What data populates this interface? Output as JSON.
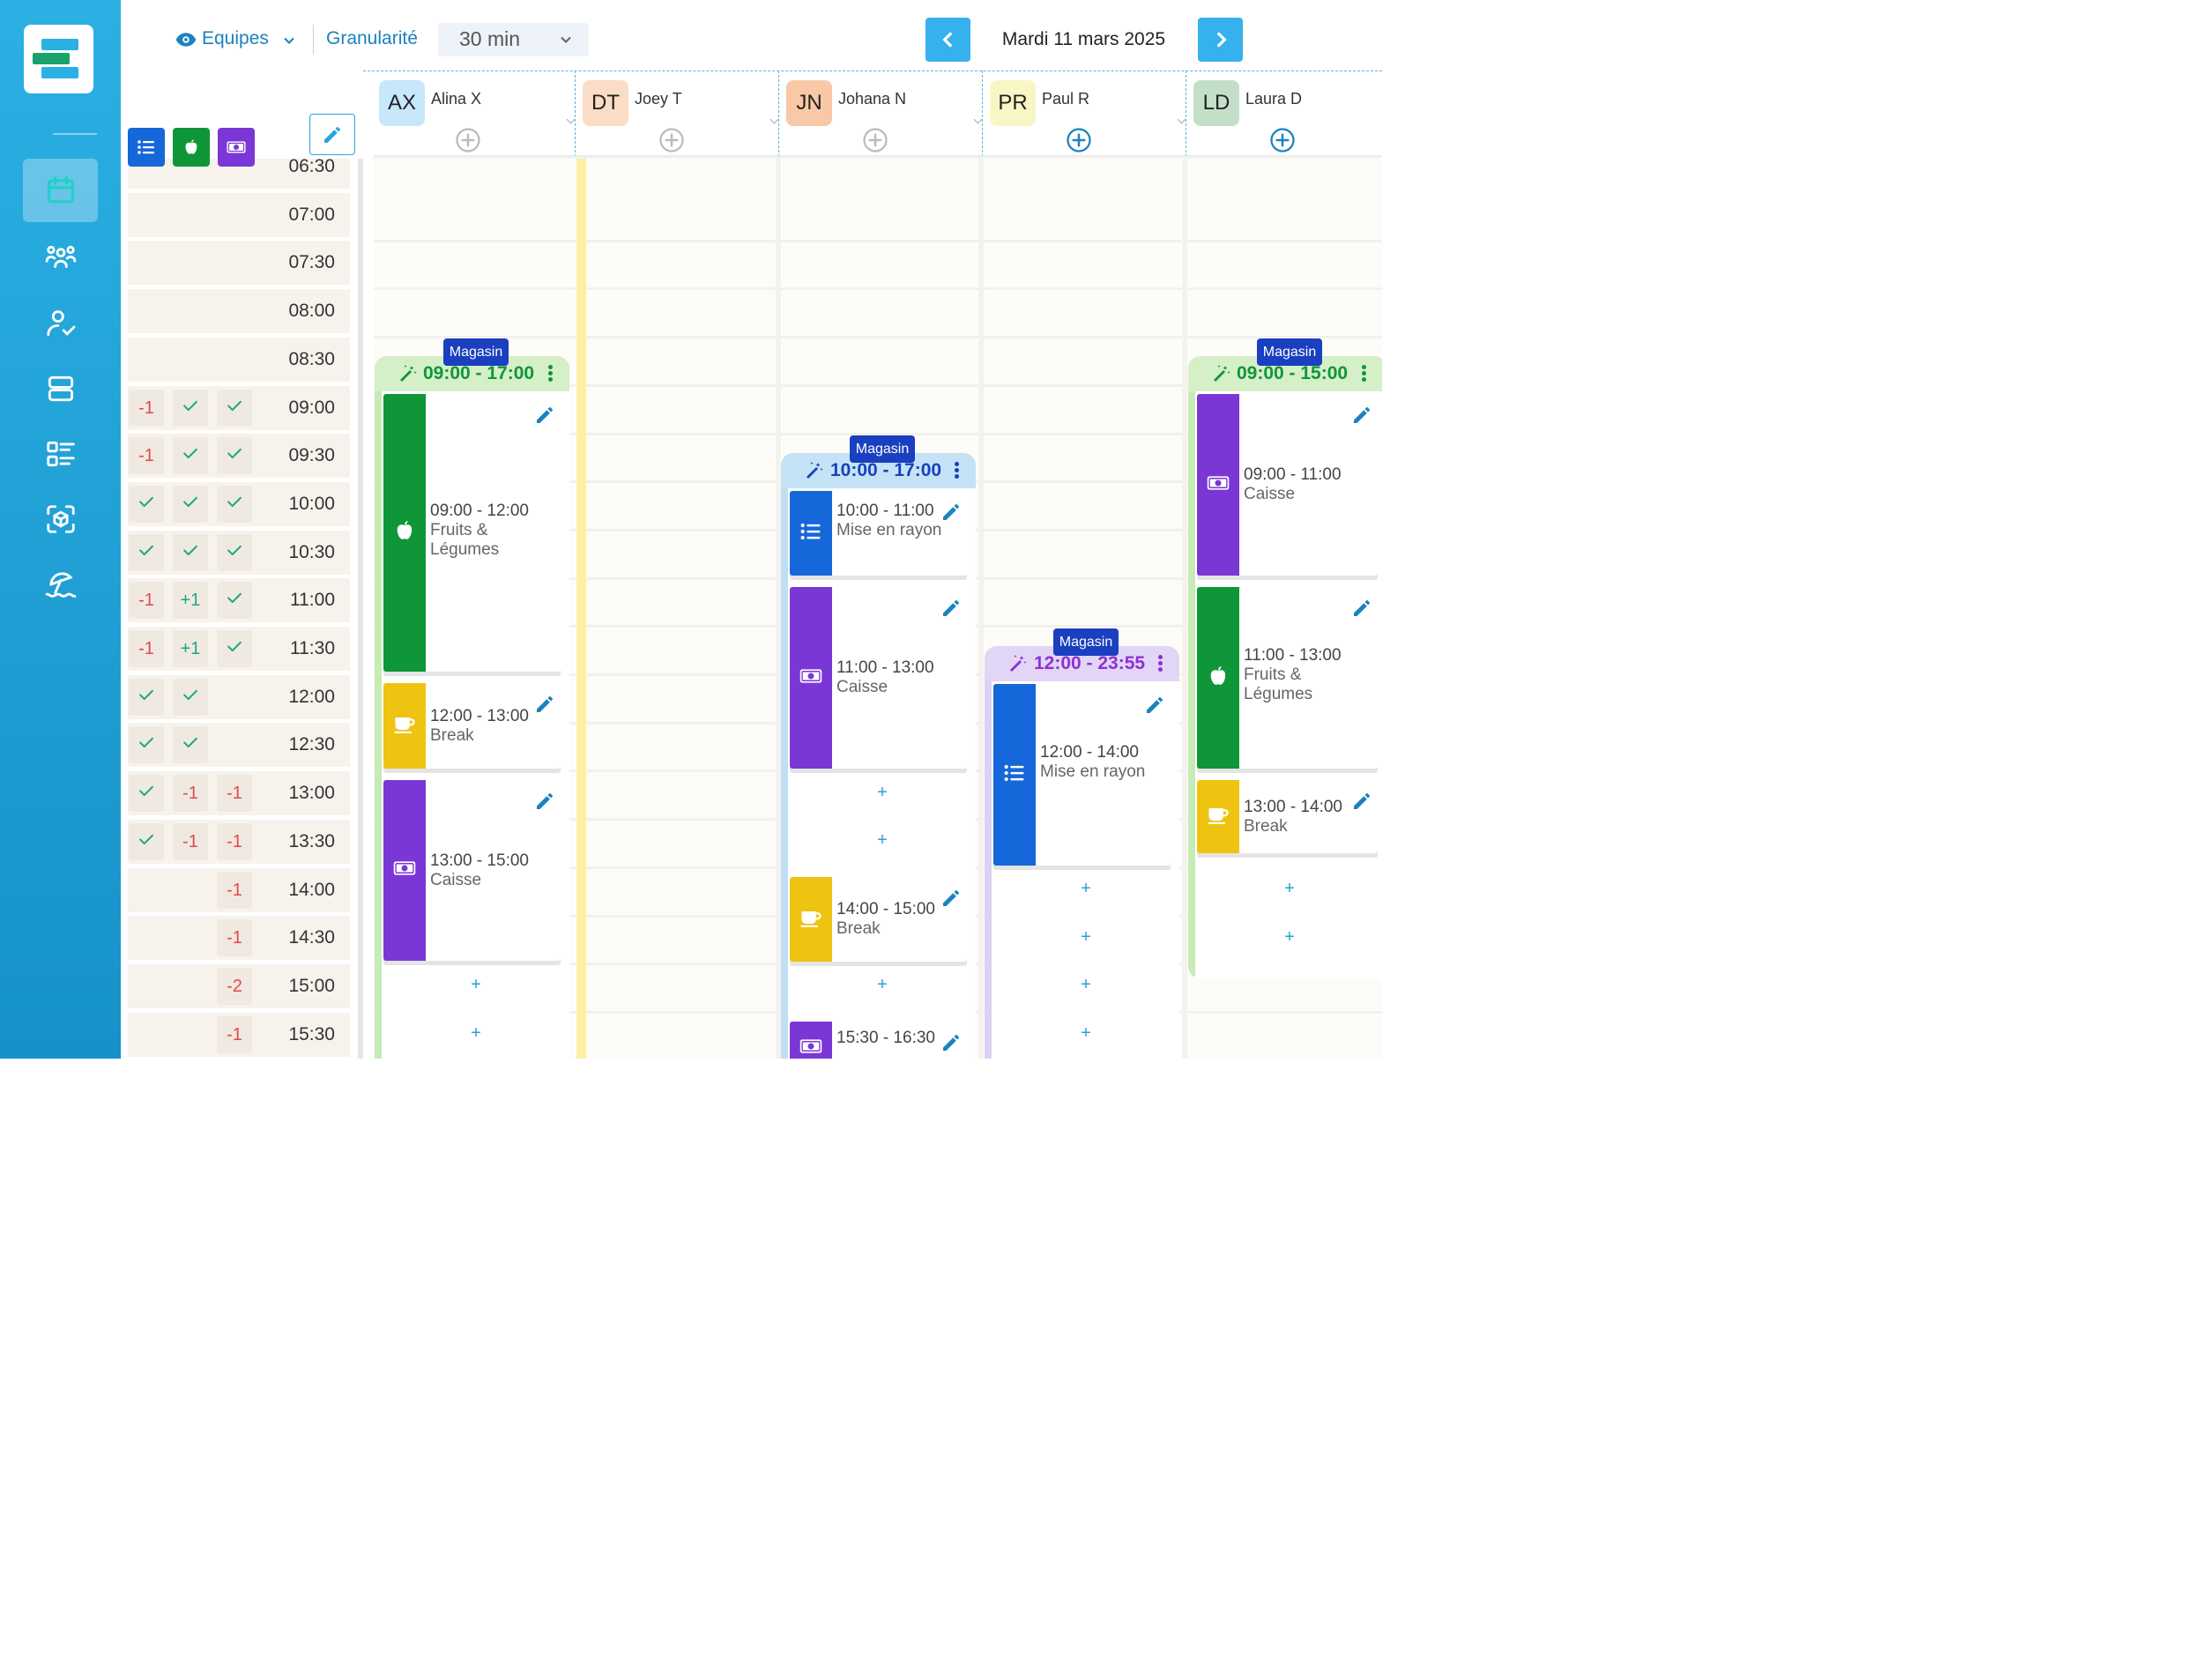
{
  "toolbar": {
    "view_label": "Equipes",
    "granularity_label": "Granularité",
    "granularity_value": "30 min",
    "date": "Mardi 11 mars 2025",
    "prev_icon": "chevron-left-icon",
    "next_icon": "chevron-right-icon"
  },
  "sidebar": {
    "items": [
      {
        "name": "calendar",
        "icon": "calendar-icon",
        "active": true
      },
      {
        "name": "teams",
        "icon": "users-group-icon"
      },
      {
        "name": "user-check",
        "icon": "user-check-icon"
      },
      {
        "name": "layout",
        "icon": "layout-rows-icon"
      },
      {
        "name": "task-list",
        "icon": "task-list-icon"
      },
      {
        "name": "scan",
        "icon": "scan-cube-icon"
      },
      {
        "name": "vacation",
        "icon": "beach-umbrella-icon"
      }
    ]
  },
  "activity_tags": [
    {
      "icon": "list-icon",
      "color": "#1667d9"
    },
    {
      "icon": "apple-icon",
      "color": "#0f9638"
    },
    {
      "icon": "money-icon",
      "color": "#7a37d6"
    }
  ],
  "employees": [
    {
      "initials": "AX",
      "name": "Alina X",
      "color": "#c7e7fb"
    },
    {
      "initials": "DT",
      "name": "Joey T",
      "color": "#fbdcc6"
    },
    {
      "initials": "JN",
      "name": "Johana N",
      "color": "#f9c8a6"
    },
    {
      "initials": "PR",
      "name": "Paul R",
      "color": "#f8f6c4"
    },
    {
      "initials": "LD",
      "name": "Laura D",
      "color": "#c3dfc8"
    }
  ],
  "time_rows": [
    {
      "time": "06:30",
      "c1": "",
      "c2": "",
      "c3": ""
    },
    {
      "time": "07:00",
      "c1": "",
      "c2": "",
      "c3": ""
    },
    {
      "time": "07:30",
      "c1": "",
      "c2": "",
      "c3": ""
    },
    {
      "time": "08:00",
      "c1": "",
      "c2": "",
      "c3": ""
    },
    {
      "time": "08:30",
      "c1": "",
      "c2": "",
      "c3": ""
    },
    {
      "time": "09:00",
      "c1": "-1",
      "c2": "check",
      "c3": "check"
    },
    {
      "time": "09:30",
      "c1": "-1",
      "c2": "check",
      "c3": "check"
    },
    {
      "time": "10:00",
      "c1": "check",
      "c2": "check",
      "c3": "check"
    },
    {
      "time": "10:30",
      "c1": "check",
      "c2": "check",
      "c3": "check"
    },
    {
      "time": "11:00",
      "c1": "-1",
      "c2": "+1",
      "c3": "check"
    },
    {
      "time": "11:30",
      "c1": "-1",
      "c2": "+1",
      "c3": "check"
    },
    {
      "time": "12:00",
      "c1": "check",
      "c2": "check",
      "c3": ""
    },
    {
      "time": "12:30",
      "c1": "check",
      "c2": "check",
      "c3": ""
    },
    {
      "time": "13:00",
      "c1": "check",
      "c2": "-1",
      "c3": "-1"
    },
    {
      "time": "13:30",
      "c1": "check",
      "c2": "-1",
      "c3": "-1"
    },
    {
      "time": "14:00",
      "c1": "",
      "c2": "",
      "c3": "-1"
    },
    {
      "time": "14:30",
      "c1": "",
      "c2": "",
      "c3": "-1"
    },
    {
      "time": "15:00",
      "c1": "",
      "c2": "",
      "c3": "-2"
    },
    {
      "time": "15:30",
      "c1": "",
      "c2": "",
      "c3": "-1"
    }
  ],
  "shifts": [
    {
      "employee": "Alina X",
      "tag": "Magasin",
      "time": "09:00 - 17:00",
      "color": "#0f9638",
      "tasks": [
        {
          "time": "09:00 - 12:00",
          "label": "Fruits & Légumes",
          "icon": "apple-icon",
          "color": "#0f9638"
        },
        {
          "time": "12:00 - 13:00",
          "label": "Break",
          "icon": "coffee-cup-icon",
          "color": "#efc312"
        },
        {
          "time": "13:00 - 15:00",
          "label": "Caisse",
          "icon": "money-icon",
          "color": "#7a37d6"
        }
      ]
    },
    {
      "employee": "Johana N",
      "tag": "Magasin",
      "time": "10:00 - 17:00",
      "color": "#1a3fc0",
      "tasks": [
        {
          "time": "10:00 - 11:00",
          "label": "Mise en rayon",
          "icon": "list-icon",
          "color": "#1667d9"
        },
        {
          "time": "11:00 - 13:00",
          "label": "Caisse",
          "icon": "money-icon",
          "color": "#7a37d6"
        },
        {
          "time": "14:00 - 15:00",
          "label": "Break",
          "icon": "coffee-cup-icon",
          "color": "#efc312"
        },
        {
          "time": "15:30 - 16:30",
          "label": "",
          "icon": "money-icon",
          "color": "#7a37d6"
        }
      ]
    },
    {
      "employee": "Paul R",
      "tag": "Magasin",
      "time": "12:00 - 23:55",
      "color": "#8f30d6",
      "tasks": [
        {
          "time": "12:00 - 14:00",
          "label": "Mise en rayon",
          "icon": "list-icon",
          "color": "#1667d9"
        }
      ]
    },
    {
      "employee": "Laura D",
      "tag": "Magasin",
      "time": "09:00 - 15:00",
      "color": "#0f9638",
      "tasks": [
        {
          "time": "09:00 - 11:00",
          "label": "Caisse",
          "icon": "money-icon",
          "color": "#7a37d6"
        },
        {
          "time": "11:00 - 13:00",
          "label": "Fruits & Légumes",
          "icon": "apple-icon",
          "color": "#0f9638"
        },
        {
          "time": "13:00 - 14:00",
          "label": "Break",
          "icon": "coffee-cup-icon",
          "color": "#efc312"
        }
      ]
    }
  ],
  "add_slot_symbol": "+"
}
